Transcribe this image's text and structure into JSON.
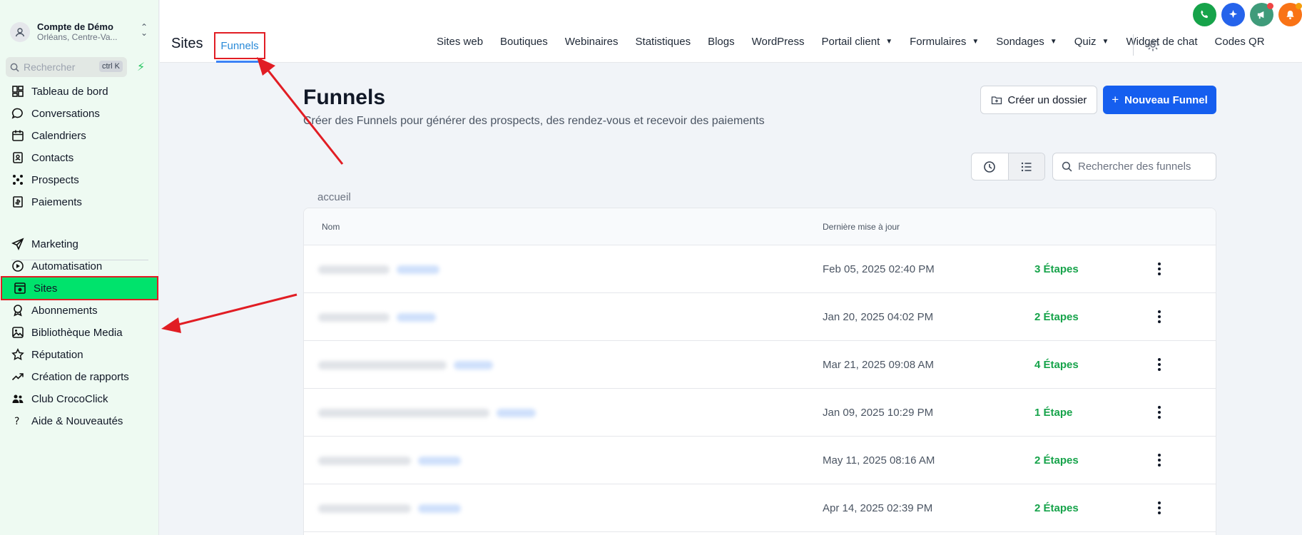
{
  "account": {
    "name": "Compte de Démo",
    "location": "Orléans, Centre-Va..."
  },
  "sidebar": {
    "search_placeholder": "Rechercher",
    "search_shortcut": "ctrl K",
    "items": [
      {
        "label": "Tableau de bord",
        "icon": "dashboard-icon"
      },
      {
        "label": "Conversations",
        "icon": "chat-icon"
      },
      {
        "label": "Calendriers",
        "icon": "calendar-icon"
      },
      {
        "label": "Contacts",
        "icon": "contacts-icon"
      },
      {
        "label": "Prospects",
        "icon": "prospects-icon"
      },
      {
        "label": "Paiements",
        "icon": "payments-icon"
      },
      {
        "label": "Marketing",
        "icon": "send-icon"
      },
      {
        "label": "Automatisation",
        "icon": "automation-icon"
      },
      {
        "label": "Sites",
        "icon": "sites-icon",
        "active": true
      },
      {
        "label": "Abonnements",
        "icon": "badge-icon"
      },
      {
        "label": "Bibliothèque Media",
        "icon": "image-icon"
      },
      {
        "label": "Réputation",
        "icon": "star-icon"
      },
      {
        "label": "Création de rapports",
        "icon": "trend-icon"
      },
      {
        "label": "Club CrocoClick",
        "icon": "users-icon"
      },
      {
        "label": "Aide & Nouveautés",
        "icon": "help-icon"
      }
    ]
  },
  "header": {
    "page_label": "Sites",
    "active_tab": "Funnels",
    "tabs": [
      {
        "label": "Sites web"
      },
      {
        "label": "Boutiques"
      },
      {
        "label": "Webinaires"
      },
      {
        "label": "Statistiques"
      },
      {
        "label": "Blogs"
      },
      {
        "label": "WordPress"
      },
      {
        "label": "Portail client",
        "dropdown": true
      },
      {
        "label": "Formulaires",
        "dropdown": true
      },
      {
        "label": "Sondages",
        "dropdown": true
      },
      {
        "label": "Quiz",
        "dropdown": true
      },
      {
        "label": "Widget de chat"
      },
      {
        "label": "Codes QR"
      }
    ],
    "top_icons": [
      {
        "name": "phone-icon",
        "color": "#16a34a"
      },
      {
        "name": "sparkle-icon",
        "color": "#2563eb"
      },
      {
        "name": "megaphone-icon",
        "color": "#3f9b7a"
      },
      {
        "name": "bell-icon",
        "color": "#f97316"
      }
    ]
  },
  "main": {
    "title": "Funnels",
    "subtitle": "Créer des Funnels pour générer des prospects, des rendez-vous et recevoir des paiements",
    "btn_folder": "Créer un dossier",
    "btn_new": "Nouveau Funnel",
    "search_placeholder": "Rechercher des funnels",
    "breadcrumb": "accueil",
    "columns": {
      "name": "Nom",
      "updated": "Dernière mise à jour"
    },
    "rows": [
      {
        "date": "Feb 05, 2025 02:40 PM",
        "steps": "3 Étapes"
      },
      {
        "date": "Jan 20, 2025 04:02 PM",
        "steps": "2 Étapes"
      },
      {
        "date": "Mar 21, 2025 09:08 AM",
        "steps": "4 Étapes"
      },
      {
        "date": "Jan 09, 2025 10:29 PM",
        "steps": "1 Étape"
      },
      {
        "date": "May 11, 2025 08:16 AM",
        "steps": "2 Étapes"
      },
      {
        "date": "Apr 14, 2025 02:39 PM",
        "steps": "2 Étapes"
      }
    ]
  },
  "colors": {
    "accent": "#155eef",
    "sidebar_active": "#00e36c",
    "annotation": "#e11d24",
    "success": "#16a34a"
  }
}
